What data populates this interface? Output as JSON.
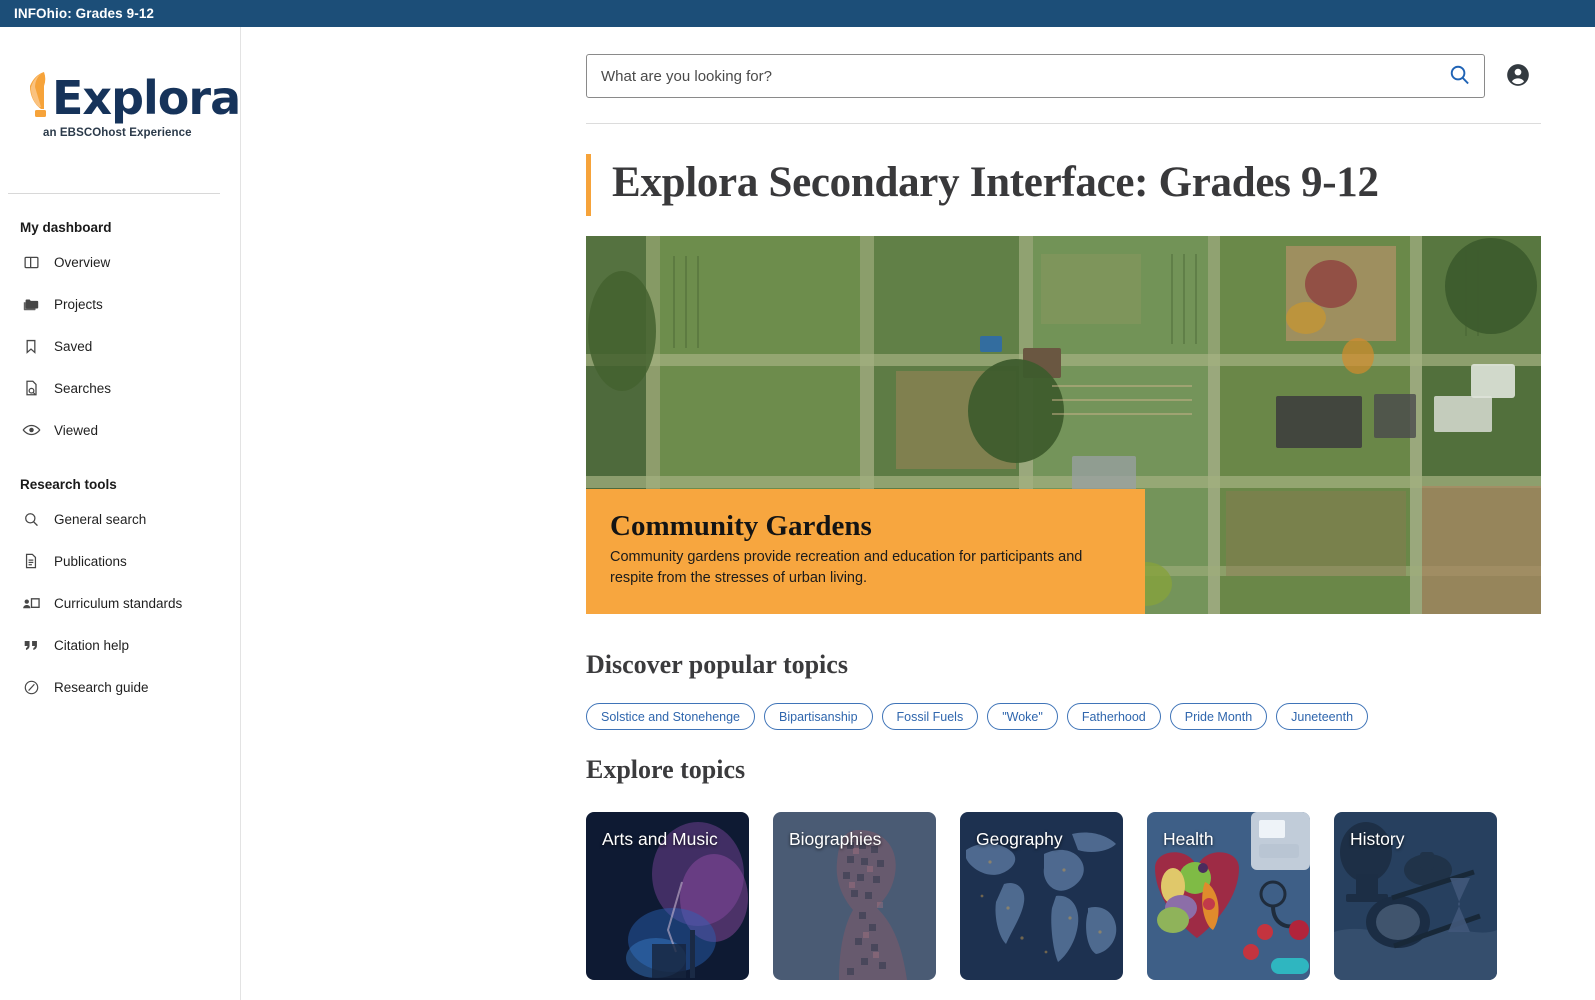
{
  "topbar": {
    "title": "INFOhio: Grades 9-12"
  },
  "brand": {
    "word": "Explora",
    "tagline": "an EBSCOhost Experience",
    "balloon_color": "#f6a33a",
    "word_color": "#16335a"
  },
  "sidebar": {
    "groups": [
      {
        "title": "My dashboard",
        "items": [
          {
            "label": "Overview",
            "icon": "layout-icon"
          },
          {
            "label": "Projects",
            "icon": "folders-icon"
          },
          {
            "label": "Saved",
            "icon": "bookmark-icon"
          },
          {
            "label": "Searches",
            "icon": "document-search-icon"
          },
          {
            "label": "Viewed",
            "icon": "eye-icon"
          }
        ]
      },
      {
        "title": "Research tools",
        "items": [
          {
            "label": "General search",
            "icon": "search-icon"
          },
          {
            "label": "Publications",
            "icon": "document-icon"
          },
          {
            "label": "Curriculum standards",
            "icon": "presentation-icon"
          },
          {
            "label": "Citation help",
            "icon": "quote-icon"
          },
          {
            "label": "Research guide",
            "icon": "compass-icon"
          }
        ]
      }
    ]
  },
  "search": {
    "value": "",
    "placeholder": "What are you looking for?",
    "search_icon": "search-icon",
    "account_icon": "account-circle-icon"
  },
  "page": {
    "title": "Explora Secondary Interface: Grades 9-12",
    "accent_color": "#f6a33a"
  },
  "hero": {
    "title": "Community Gardens",
    "description": "Community gardens provide recreation and education for participants and respite from the stresses of urban living.",
    "image_alt": "aerial-view-of-community-garden-allotments",
    "overlay_color": "#f7a63f"
  },
  "popular": {
    "heading": "Discover popular topics",
    "chips": [
      "Solstice and Stonehenge",
      "Bipartisanship",
      "Fossil Fuels",
      "\"Woke\"",
      "Fatherhood",
      "Pride Month",
      "Juneteenth"
    ]
  },
  "explore": {
    "heading": "Explore topics",
    "cards": [
      {
        "label": "Arts and Music",
        "art": "arts-music"
      },
      {
        "label": "Biographies",
        "art": "biographies"
      },
      {
        "label": "Geography",
        "art": "geography"
      },
      {
        "label": "Health",
        "art": "health"
      },
      {
        "label": "History",
        "art": "history"
      }
    ]
  }
}
